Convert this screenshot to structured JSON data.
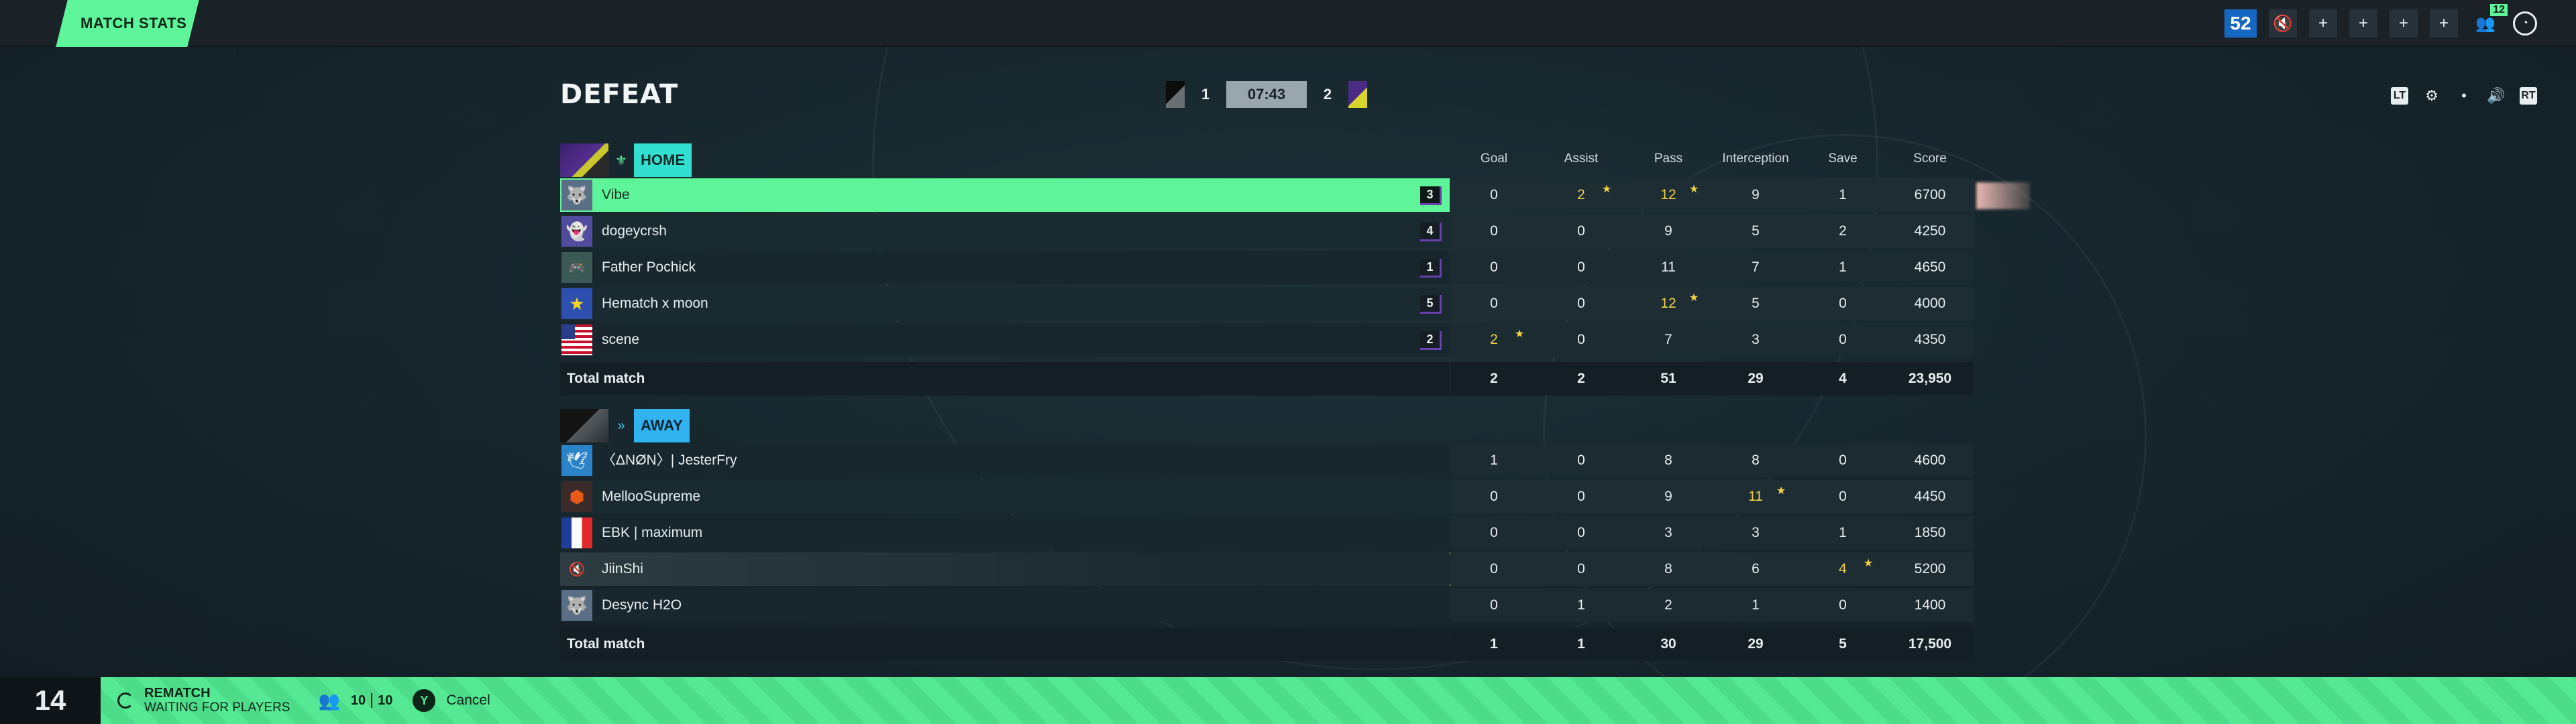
{
  "topbar": {
    "tab_label": "MATCH STATS",
    "level": "52",
    "party_count": "12",
    "icons": [
      "mute-icon",
      "add-friend-icon",
      "add-friend-icon",
      "add-friend-icon",
      "add-friend-icon",
      "party-icon",
      "round-icon"
    ]
  },
  "header": {
    "result": "DEFEAT",
    "home_score": "1",
    "away_score": "2",
    "timer": "07:43",
    "controls": [
      "lb-icon",
      "settings-icon",
      "dot-icon",
      "volume-icon",
      "rb-icon"
    ],
    "controls_text": {
      "lb": "LT",
      "rb": "RT",
      "dot": "•"
    }
  },
  "columns": [
    "Goal",
    "Assist",
    "Pass",
    "Interception",
    "Save",
    "Score"
  ],
  "home": {
    "label": "HOME",
    "players": [
      {
        "name": "Vibe",
        "avatar": "wolf-icon",
        "rank": "3",
        "stats": [
          "0",
          "2",
          "12",
          "9",
          "1",
          "6700"
        ],
        "best": [
          false,
          true,
          true,
          false,
          false,
          false
        ],
        "highlight": true
      },
      {
        "name": "dogeycrsh",
        "avatar": "ghost-icon",
        "rank": "4",
        "stats": [
          "0",
          "0",
          "9",
          "5",
          "2",
          "4250"
        ],
        "best": [
          false,
          false,
          false,
          false,
          false,
          false
        ]
      },
      {
        "name": "Father Pochick",
        "avatar": "gamepad-icon",
        "rank": "1",
        "stats": [
          "0",
          "0",
          "11",
          "7",
          "1",
          "4650"
        ],
        "best": [
          false,
          false,
          false,
          false,
          false,
          false
        ]
      },
      {
        "name": "Hematch x moon",
        "avatar": "star-icon",
        "rank": "5",
        "stats": [
          "0",
          "0",
          "12",
          "5",
          "0",
          "4000"
        ],
        "best": [
          false,
          false,
          true,
          false,
          false,
          false
        ]
      },
      {
        "name": "scene",
        "avatar": "us-flag-icon",
        "rank": "2",
        "stats": [
          "2",
          "0",
          "7",
          "3",
          "0",
          "4350"
        ],
        "best": [
          true,
          false,
          false,
          false,
          false,
          false
        ]
      }
    ],
    "total_label": "Total match",
    "totals": [
      "2",
      "2",
      "51",
      "29",
      "4",
      "23,950"
    ]
  },
  "away": {
    "label": "AWAY",
    "players": [
      {
        "name": "〈ΔNØN〉| JesterFry",
        "avatar": "bird-icon",
        "stats": [
          "1",
          "0",
          "8",
          "8",
          "0",
          "4600"
        ],
        "best": [
          false,
          false,
          false,
          false,
          false,
          false
        ]
      },
      {
        "name": "MellooSupreme",
        "avatar": "orange-emblem-icon",
        "stats": [
          "0",
          "0",
          "9",
          "11",
          "0",
          "4450"
        ],
        "best": [
          false,
          false,
          false,
          true,
          false,
          false
        ]
      },
      {
        "name": "EBK | maximum",
        "avatar": "fr-flag-icon",
        "stats": [
          "0",
          "0",
          "3",
          "3",
          "1",
          "1850"
        ],
        "best": [
          false,
          false,
          false,
          false,
          false,
          false
        ]
      },
      {
        "name": "JiinShi",
        "avatar": "muted-speaker-icon",
        "stats": [
          "0",
          "0",
          "8",
          "6",
          "4",
          "5200"
        ],
        "best": [
          false,
          false,
          false,
          false,
          true,
          false
        ],
        "highlight": true
      },
      {
        "name": "Desync H2O",
        "avatar": "wolf-icon",
        "stats": [
          "0",
          "1",
          "2",
          "1",
          "0",
          "1400"
        ],
        "best": [
          false,
          false,
          false,
          false,
          false,
          false
        ]
      }
    ],
    "total_label": "Total match",
    "totals": [
      "1",
      "1",
      "30",
      "29",
      "5",
      "17,500"
    ]
  },
  "bottom": {
    "countdown": "14",
    "rematch_title": "REMATCH",
    "rematch_sub": "WAITING FOR PLAYERS",
    "players_ready": "10",
    "players_total": "10",
    "button_glyph": "Y",
    "cancel_label": "Cancel"
  },
  "colors": {
    "accent_green": "#5ef59a",
    "home": "#33e0d0",
    "away": "#31b3f0",
    "best_stat": "#f2d245",
    "highlight_away_border": "#d9b533"
  }
}
